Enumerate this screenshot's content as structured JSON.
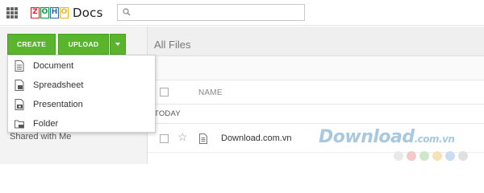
{
  "app": {
    "logo_text": "ZOHO",
    "name": "Docs",
    "logo_letters": [
      {
        "char": "Z",
        "color": "#e42527"
      },
      {
        "char": "O",
        "color": "#089949"
      },
      {
        "char": "H",
        "color": "#226db4"
      },
      {
        "char": "O",
        "color": "#f9b21d"
      }
    ]
  },
  "search": {
    "placeholder": ""
  },
  "sidebar": {
    "create_label": "CREATE",
    "upload_label": "UPLOAD",
    "shared_label": "Shared with Me",
    "accent_color": "#5ab52c"
  },
  "create_menu": {
    "items": [
      {
        "label": "Document",
        "icon": "document-icon"
      },
      {
        "label": "Spreadsheet",
        "icon": "spreadsheet-icon"
      },
      {
        "label": "Presentation",
        "icon": "presentation-icon"
      },
      {
        "label": "Folder",
        "icon": "folder-icon"
      }
    ]
  },
  "main": {
    "title": "All Files",
    "column_name": "NAME",
    "group_label": "TODAY",
    "files": [
      {
        "name": "Download.com.vn",
        "icon": "document-icon",
        "starred": false
      }
    ]
  },
  "watermark": {
    "text": "Download",
    "suffix": ".com.vn",
    "dot_colors": [
      "#e9e9e9",
      "#f3c8c8",
      "#cde8c8",
      "#f5e3b8",
      "#c8ddef",
      "#e0e0e0"
    ]
  }
}
